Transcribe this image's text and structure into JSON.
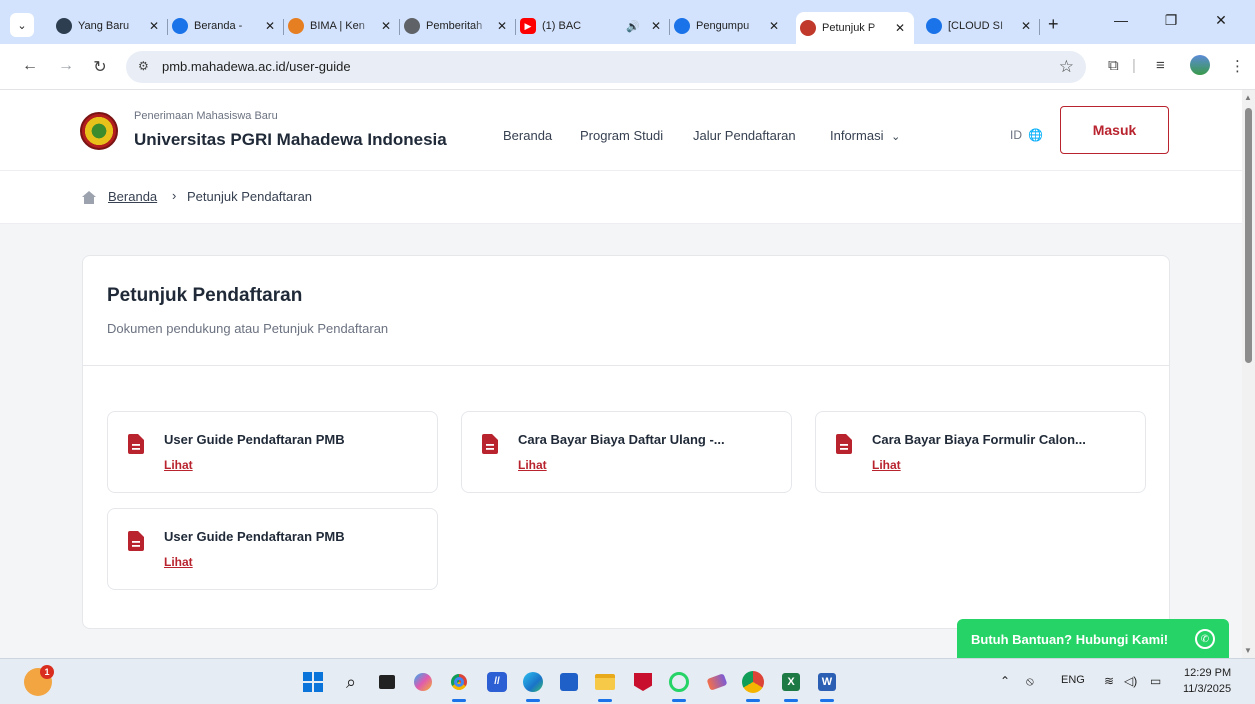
{
  "browser": {
    "tabs": [
      {
        "title": "Yang Baru",
        "color": "#2c3e50"
      },
      {
        "title": "Beranda -",
        "color": "#1a73e8"
      },
      {
        "title": "BIMA | Ken",
        "color": "#e67e22"
      },
      {
        "title": "Pemberitah",
        "color": "#5f6368"
      },
      {
        "title": "(1) BAC",
        "color": "#ff0000"
      },
      {
        "title": "Pengumpu",
        "color": "#1a73e8"
      },
      {
        "title": "Petunjuk P",
        "color": "#c0392b"
      },
      {
        "title": "[CLOUD SI",
        "color": "#1a73e8"
      }
    ],
    "new_tab": "+",
    "url": "pmb.mahadewa.ac.id/user-guide"
  },
  "header": {
    "brand_sub": "Penerimaan Mahasiswa Baru",
    "brand_title": "Universitas PGRI Mahadewa Indonesia",
    "nav": [
      "Beranda",
      "Program Studi",
      "Jalur Pendaftaran",
      "Informasi"
    ],
    "lang": "ID",
    "login": "Masuk"
  },
  "breadcrumb": {
    "home": "Beranda",
    "separator": "›",
    "current": "Petunjuk Pendaftaran"
  },
  "card": {
    "title": "Petunjuk Pendaftaran",
    "subtitle": "Dokumen pendukung atau Petunjuk Pendaftaran",
    "documents": [
      {
        "name": "User Guide Pendaftaran PMB",
        "link": "Lihat"
      },
      {
        "name": "Cara Bayar Biaya Daftar Ulang -...",
        "link": "Lihat"
      },
      {
        "name": "Cara Bayar Biaya Formulir Calon...",
        "link": "Lihat"
      },
      {
        "name": "User Guide Pendaftaran PMB",
        "link": "Lihat"
      }
    ]
  },
  "help": {
    "label": "Butuh Bantuan? Hubungi Kami!"
  },
  "taskbar": {
    "weather_badge": "1",
    "lang": "ENG",
    "time": "12:29 PM",
    "date": "11/3/2025"
  },
  "colors": {
    "accent": "#b8232e",
    "whatsapp": "#25d366",
    "tabstrip": "#d3e3fd"
  }
}
